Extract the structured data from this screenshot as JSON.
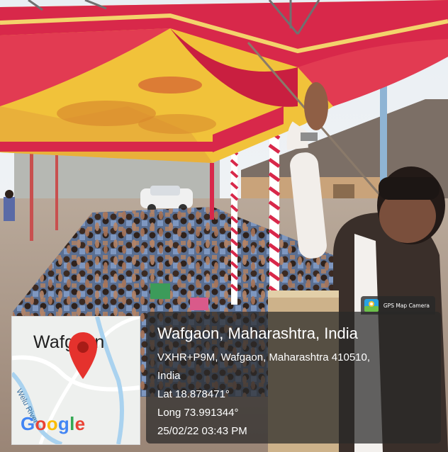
{
  "photo": {
    "description_icon": "crowd-photo"
  },
  "map": {
    "place_label": "Wafgaon",
    "river_label": "Welu River",
    "google_logo": "Google"
  },
  "brand": {
    "app_name": "GPS Map Camera",
    "icon": "gps-map-camera-icon"
  },
  "location": {
    "title": "Wafgaon, Maharashtra, India",
    "address_line1": "VXHR+P9M, Wafgaon, Maharashtra 410510,",
    "address_line2": "India",
    "latitude": "Lat 18.878471°",
    "longitude": "Long 73.991344°",
    "datetime": "25/02/22 03:43 PM"
  },
  "colors": {
    "canopy_red": "#d8284a",
    "canopy_yellow": "#f1c23a",
    "pin_red": "#e5322d",
    "google_blue": "#4285F4",
    "google_red": "#EA4335",
    "google_yellow": "#FBBC05",
    "google_green": "#34A853"
  }
}
